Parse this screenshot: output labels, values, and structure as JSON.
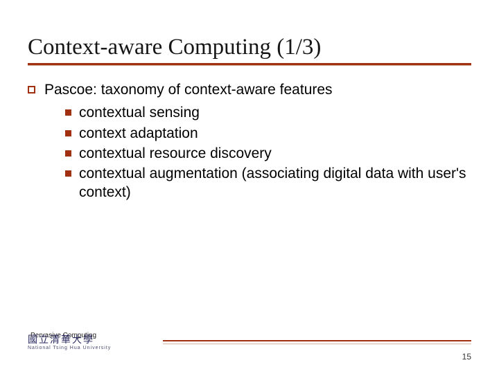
{
  "title": "Context-aware Computing (1/3)",
  "main_point": "Pascoe: taxonomy of context-aware features",
  "sub_points": [
    "contextual sensing",
    "context adaptation",
    "contextual resource discovery",
    "contextual augmentation (associating digital data with user's context)"
  ],
  "footer": {
    "course": "Pervasive Computing",
    "uni_cn": "國立清華大學",
    "uni_en": "National Tsing Hua University",
    "page": "15"
  }
}
